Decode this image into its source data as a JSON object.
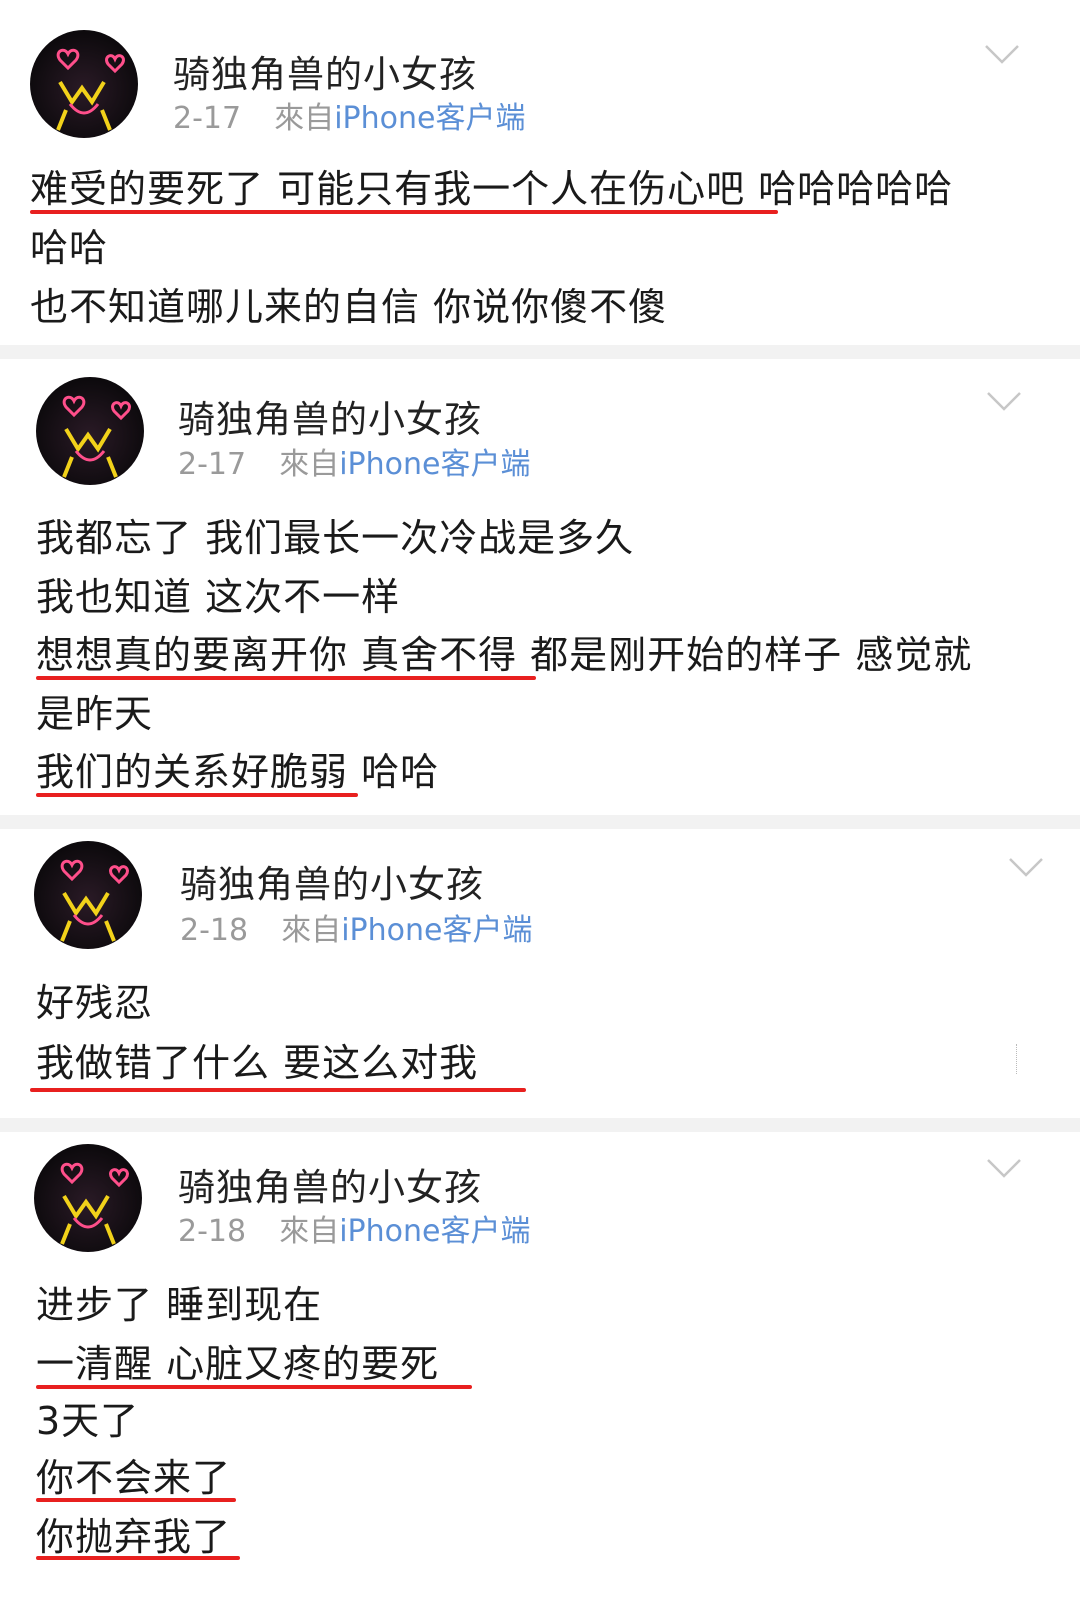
{
  "posts": [
    {
      "user": "骑独角兽的小女孩",
      "date": "2-17",
      "from_prefix": "來自",
      "from_client": "iPhone客户端",
      "lines": [
        "难受的要死了 可能只有我一个人在伤心吧 哈哈哈哈哈",
        "哈哈",
        "也不知道哪儿来的自信 你说你傻不傻"
      ]
    },
    {
      "user": "骑独角兽的小女孩",
      "date": "2-17",
      "from_prefix": "來自",
      "from_client": "iPhone客户端",
      "lines": [
        "我都忘了 我们最长一次冷战是多久",
        "我也知道 这次不一样",
        "想想真的要离开你 真舍不得 都是刚开始的样子 感觉就",
        "是昨天",
        "我们的关系好脆弱  哈哈"
      ]
    },
    {
      "user": "骑独角兽的小女孩",
      "date": "2-18",
      "from_prefix": "來自",
      "from_client": "iPhone客户端",
      "lines": [
        "好残忍",
        "我做错了什么 要这么对我"
      ]
    },
    {
      "user": "骑独角兽的小女孩",
      "date": "2-18",
      "from_prefix": "來自",
      "from_client": "iPhone客户端",
      "lines": [
        "进步了 睡到现在",
        "一清醒 心脏又疼的要死",
        "3天了",
        "你不会来了",
        "你抛弃我了"
      ]
    }
  ],
  "colors": {
    "underline": "#e8201f",
    "client_link": "#5b8fd6",
    "meta_gray": "#9a9a9a",
    "separator": "#f2f2f2"
  },
  "icons": {
    "avatar": "anime-girl-neon-hearts-avatar",
    "menu": "chevron-down-icon"
  }
}
